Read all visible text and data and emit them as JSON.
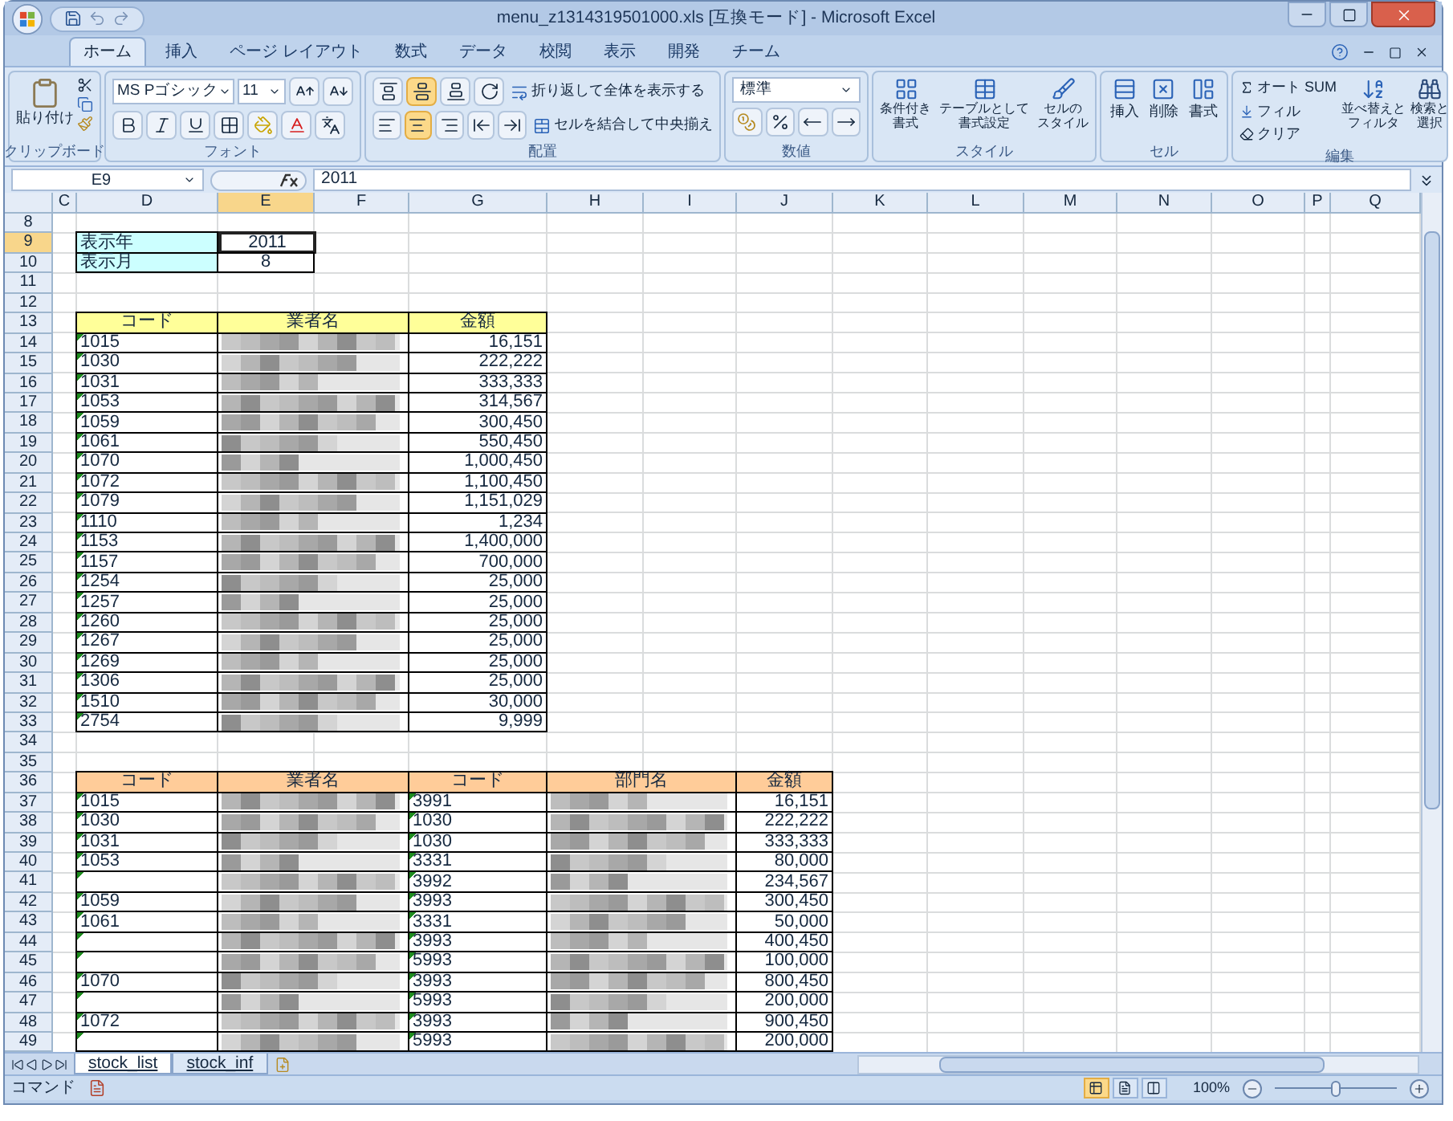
{
  "window": {
    "title": "menu_z1314319501000.xls [互換モード] - Microsoft Excel"
  },
  "ribbon_tabs": [
    {
      "label": "ホーム",
      "selected": true
    },
    {
      "label": "挿入",
      "selected": false
    },
    {
      "label": "ページ レイアウト",
      "selected": false
    },
    {
      "label": "数式",
      "selected": false
    },
    {
      "label": "データ",
      "selected": false
    },
    {
      "label": "校閲",
      "selected": false
    },
    {
      "label": "表示",
      "selected": false
    },
    {
      "label": "開発",
      "selected": false
    },
    {
      "label": "チーム",
      "selected": false
    }
  ],
  "clipboard": {
    "paste_label": "貼り付け",
    "group_label": "クリップボード"
  },
  "font": {
    "name": "MS Pゴシック",
    "size": "11",
    "group_label": "フォント"
  },
  "alignment": {
    "vertical_buttons": [
      {
        "selected": false
      },
      {
        "selected": true
      },
      {
        "selected": false
      }
    ],
    "horizontal_buttons": [
      {
        "selected": false
      },
      {
        "selected": true
      },
      {
        "selected": false
      }
    ],
    "wrap_label": "折り返して全体を表示する",
    "merge_label": "セルを結合して中央揃え",
    "group_label": "配置"
  },
  "number": {
    "format": "標準",
    "group_label": "数値"
  },
  "styles": {
    "buttons": [
      {
        "lines": [
          "条件付き",
          "書式"
        ]
      },
      {
        "lines": [
          "テーブルとして",
          "書式設定"
        ]
      },
      {
        "lines": [
          "セルの",
          "スタイル"
        ]
      }
    ],
    "group_label": "スタイル"
  },
  "cells": {
    "buttons": [
      "挿入",
      "削除",
      "書式"
    ],
    "group_label": "セル"
  },
  "editing": {
    "autosum": "オート SUM",
    "fill": "フィル",
    "clear": "クリア",
    "sort": [
      "並べ替えと",
      "フィルタ"
    ],
    "find": [
      "検索と",
      "選択"
    ],
    "group_label": "編集"
  },
  "formula_bar": {
    "name_box": "E9",
    "formula": "2011"
  },
  "columns": [
    {
      "label": "C",
      "selected": false
    },
    {
      "label": "D",
      "selected": false
    },
    {
      "label": "E",
      "selected": true
    },
    {
      "label": "F",
      "selected": false
    },
    {
      "label": "G",
      "selected": false
    },
    {
      "label": "H",
      "selected": false
    },
    {
      "label": "I",
      "selected": false
    },
    {
      "label": "J",
      "selected": false
    },
    {
      "label": "K",
      "selected": false
    },
    {
      "label": "L",
      "selected": false
    },
    {
      "label": "M",
      "selected": false
    },
    {
      "label": "N",
      "selected": false
    },
    {
      "label": "O",
      "selected": false
    },
    {
      "label": "P",
      "selected": false
    },
    {
      "label": "Q",
      "selected": false
    }
  ],
  "row_headers": [
    {
      "label": "8",
      "selected": false
    },
    {
      "label": "9",
      "selected": true
    },
    {
      "label": "10",
      "selected": false
    },
    {
      "label": "11",
      "selected": false
    },
    {
      "label": "12",
      "selected": false
    },
    {
      "label": "13",
      "selected": false
    },
    {
      "label": "14",
      "selected": false
    },
    {
      "label": "15",
      "selected": false
    },
    {
      "label": "16",
      "selected": false
    },
    {
      "label": "17",
      "selected": false
    },
    {
      "label": "18",
      "selected": false
    },
    {
      "label": "19",
      "selected": false
    },
    {
      "label": "20",
      "selected": false
    },
    {
      "label": "21",
      "selected": false
    },
    {
      "label": "22",
      "selected": false
    },
    {
      "label": "23",
      "selected": false
    },
    {
      "label": "24",
      "selected": false
    },
    {
      "label": "25",
      "selected": false
    },
    {
      "label": "26",
      "selected": false
    },
    {
      "label": "27",
      "selected": false
    },
    {
      "label": "28",
      "selected": false
    },
    {
      "label": "29",
      "selected": false
    },
    {
      "label": "30",
      "selected": false
    },
    {
      "label": "31",
      "selected": false
    },
    {
      "label": "32",
      "selected": false
    },
    {
      "label": "33",
      "selected": false
    },
    {
      "label": "34",
      "selected": false
    },
    {
      "label": "35",
      "selected": false
    },
    {
      "label": "36",
      "selected": false
    },
    {
      "label": "37",
      "selected": false
    },
    {
      "label": "38",
      "selected": false
    },
    {
      "label": "39",
      "selected": false
    },
    {
      "label": "40",
      "selected": false
    },
    {
      "label": "41",
      "selected": false
    },
    {
      "label": "42",
      "selected": false
    },
    {
      "label": "43",
      "selected": false
    },
    {
      "label": "44",
      "selected": false
    },
    {
      "label": "45",
      "selected": false
    },
    {
      "label": "46",
      "selected": false
    },
    {
      "label": "47",
      "selected": false
    },
    {
      "label": "48",
      "selected": false
    },
    {
      "label": "49",
      "selected": false
    }
  ],
  "inputs": [
    {
      "label": "表示年",
      "value": "2011",
      "selected": true
    },
    {
      "label": "表示月",
      "value": "8",
      "selected": false
    }
  ],
  "table_1": {
    "columns": [
      "コード",
      "業者名",
      "金額"
    ],
    "rows": [
      {
        "code": "1015",
        "amount": "16,151"
      },
      {
        "code": "1030",
        "amount": "222,222"
      },
      {
        "code": "1031",
        "amount": "333,333"
      },
      {
        "code": "1053",
        "amount": "314,567"
      },
      {
        "code": "1059",
        "amount": "300,450"
      },
      {
        "code": "1061",
        "amount": "550,450"
      },
      {
        "code": "1070",
        "amount": "1,000,450"
      },
      {
        "code": "1072",
        "amount": "1,100,450"
      },
      {
        "code": "1079",
        "amount": "1,151,029"
      },
      {
        "code": "1110",
        "amount": "1,234"
      },
      {
        "code": "1153",
        "amount": "1,400,000"
      },
      {
        "code": "1157",
        "amount": "700,000"
      },
      {
        "code": "1254",
        "amount": "25,000"
      },
      {
        "code": "1257",
        "amount": "25,000"
      },
      {
        "code": "1260",
        "amount": "25,000"
      },
      {
        "code": "1267",
        "amount": "25,000"
      },
      {
        "code": "1269",
        "amount": "25,000"
      },
      {
        "code": "1306",
        "amount": "25,000"
      },
      {
        "code": "1510",
        "amount": "30,000"
      },
      {
        "code": "2754",
        "amount": "9,999"
      }
    ]
  },
  "table_2": {
    "columns": [
      "コード",
      "業者名",
      "コード",
      "部門名",
      "金額"
    ],
    "rows": [
      {
        "code": "1015",
        "dept_code": "3991",
        "amount": "16,151"
      },
      {
        "code": "1030",
        "dept_code": "1030",
        "amount": "222,222"
      },
      {
        "code": "1031",
        "dept_code": "1030",
        "amount": "333,333"
      },
      {
        "code": "1053",
        "dept_code": "3331",
        "amount": "80,000"
      },
      {
        "dept_code": "3992",
        "amount": "234,567"
      },
      {
        "code": "1059",
        "dept_code": "3993",
        "amount": "300,450"
      },
      {
        "code": "1061",
        "dept_code": "3331",
        "amount": "50,000"
      },
      {
        "dept_code": "3993",
        "amount": "400,450"
      },
      {
        "dept_code": "5993",
        "amount": "100,000"
      },
      {
        "code": "1070",
        "dept_code": "3993",
        "amount": "800,450"
      },
      {
        "dept_code": "5993",
        "amount": "200,000"
      },
      {
        "code": "1072",
        "dept_code": "3993",
        "amount": "900,450"
      },
      {
        "dept_code": "5993",
        "amount": "200,000"
      }
    ]
  },
  "sheet_tabs": [
    {
      "label": "stock_list",
      "selected": true
    },
    {
      "label": "stock_inf",
      "selected": false
    }
  ],
  "status_bar": {
    "mode": "コマンド",
    "views": [
      {
        "selected": true
      },
      {
        "selected": false
      },
      {
        "selected": false
      }
    ],
    "zoom": "100%",
    "zoom_slider": {
      "level": 0.5
    }
  }
}
